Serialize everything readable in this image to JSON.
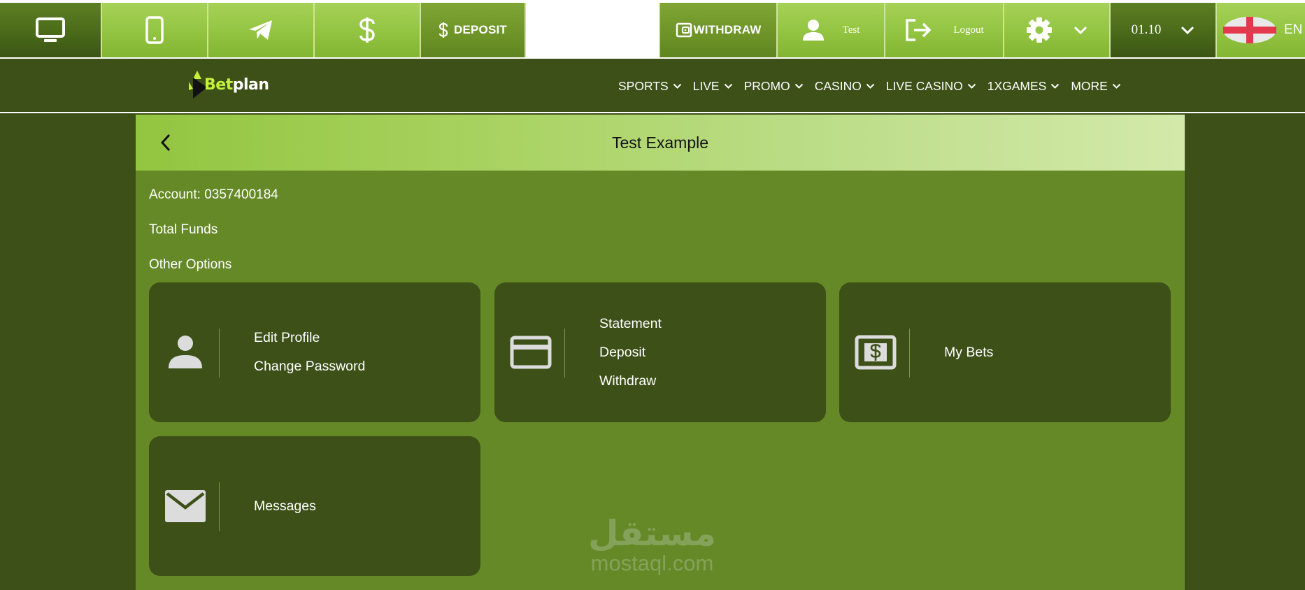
{
  "topbar": {
    "icons": {
      "desktop": "desktop-icon",
      "mobile": "mobile-icon",
      "telegram": "telegram-icon",
      "dollar": "dollar-icon",
      "wallet": "wallet-icon",
      "user": "user-icon",
      "logout": "logout-icon",
      "settings": "gear-icon",
      "flag": "england-flag-icon"
    },
    "deposit_label": "DEPOSIT",
    "withdraw_label": "WITHDRAW",
    "username": "Test",
    "logout_label": "Logout",
    "odds_format": "01.10",
    "language": "EN"
  },
  "nav": {
    "logo": {
      "part1": "Bet",
      "part2": "plan"
    },
    "items": [
      {
        "label": "SPORTS"
      },
      {
        "label": "LIVE"
      },
      {
        "label": "PROMO"
      },
      {
        "label": "CASINO"
      },
      {
        "label": "LIVE CASINO"
      },
      {
        "label": "1XGAMES"
      },
      {
        "label": "MORE"
      }
    ]
  },
  "account": {
    "title": "Test Example",
    "account_line": "Account: 0357400184",
    "total_funds_label": "Total Funds",
    "other_options_label": "Other Options",
    "cards": [
      {
        "icon": "user-icon",
        "links": [
          "Edit Profile",
          "Change Password"
        ]
      },
      {
        "icon": "credit-card-icon",
        "links": [
          "Statement",
          "Deposit",
          "Withdraw"
        ]
      },
      {
        "icon": "money-bill-icon",
        "links": [
          "My Bets"
        ]
      },
      {
        "icon": "envelope-icon",
        "links": [
          "Messages"
        ]
      }
    ]
  },
  "watermark": {
    "text": "mostaql.com",
    "arabic": "مستقل"
  },
  "colors": {
    "dark_green": "#3d5018",
    "panel_green": "#668928",
    "light_green": "#94c543",
    "logo_accent": "#c4f13a"
  }
}
